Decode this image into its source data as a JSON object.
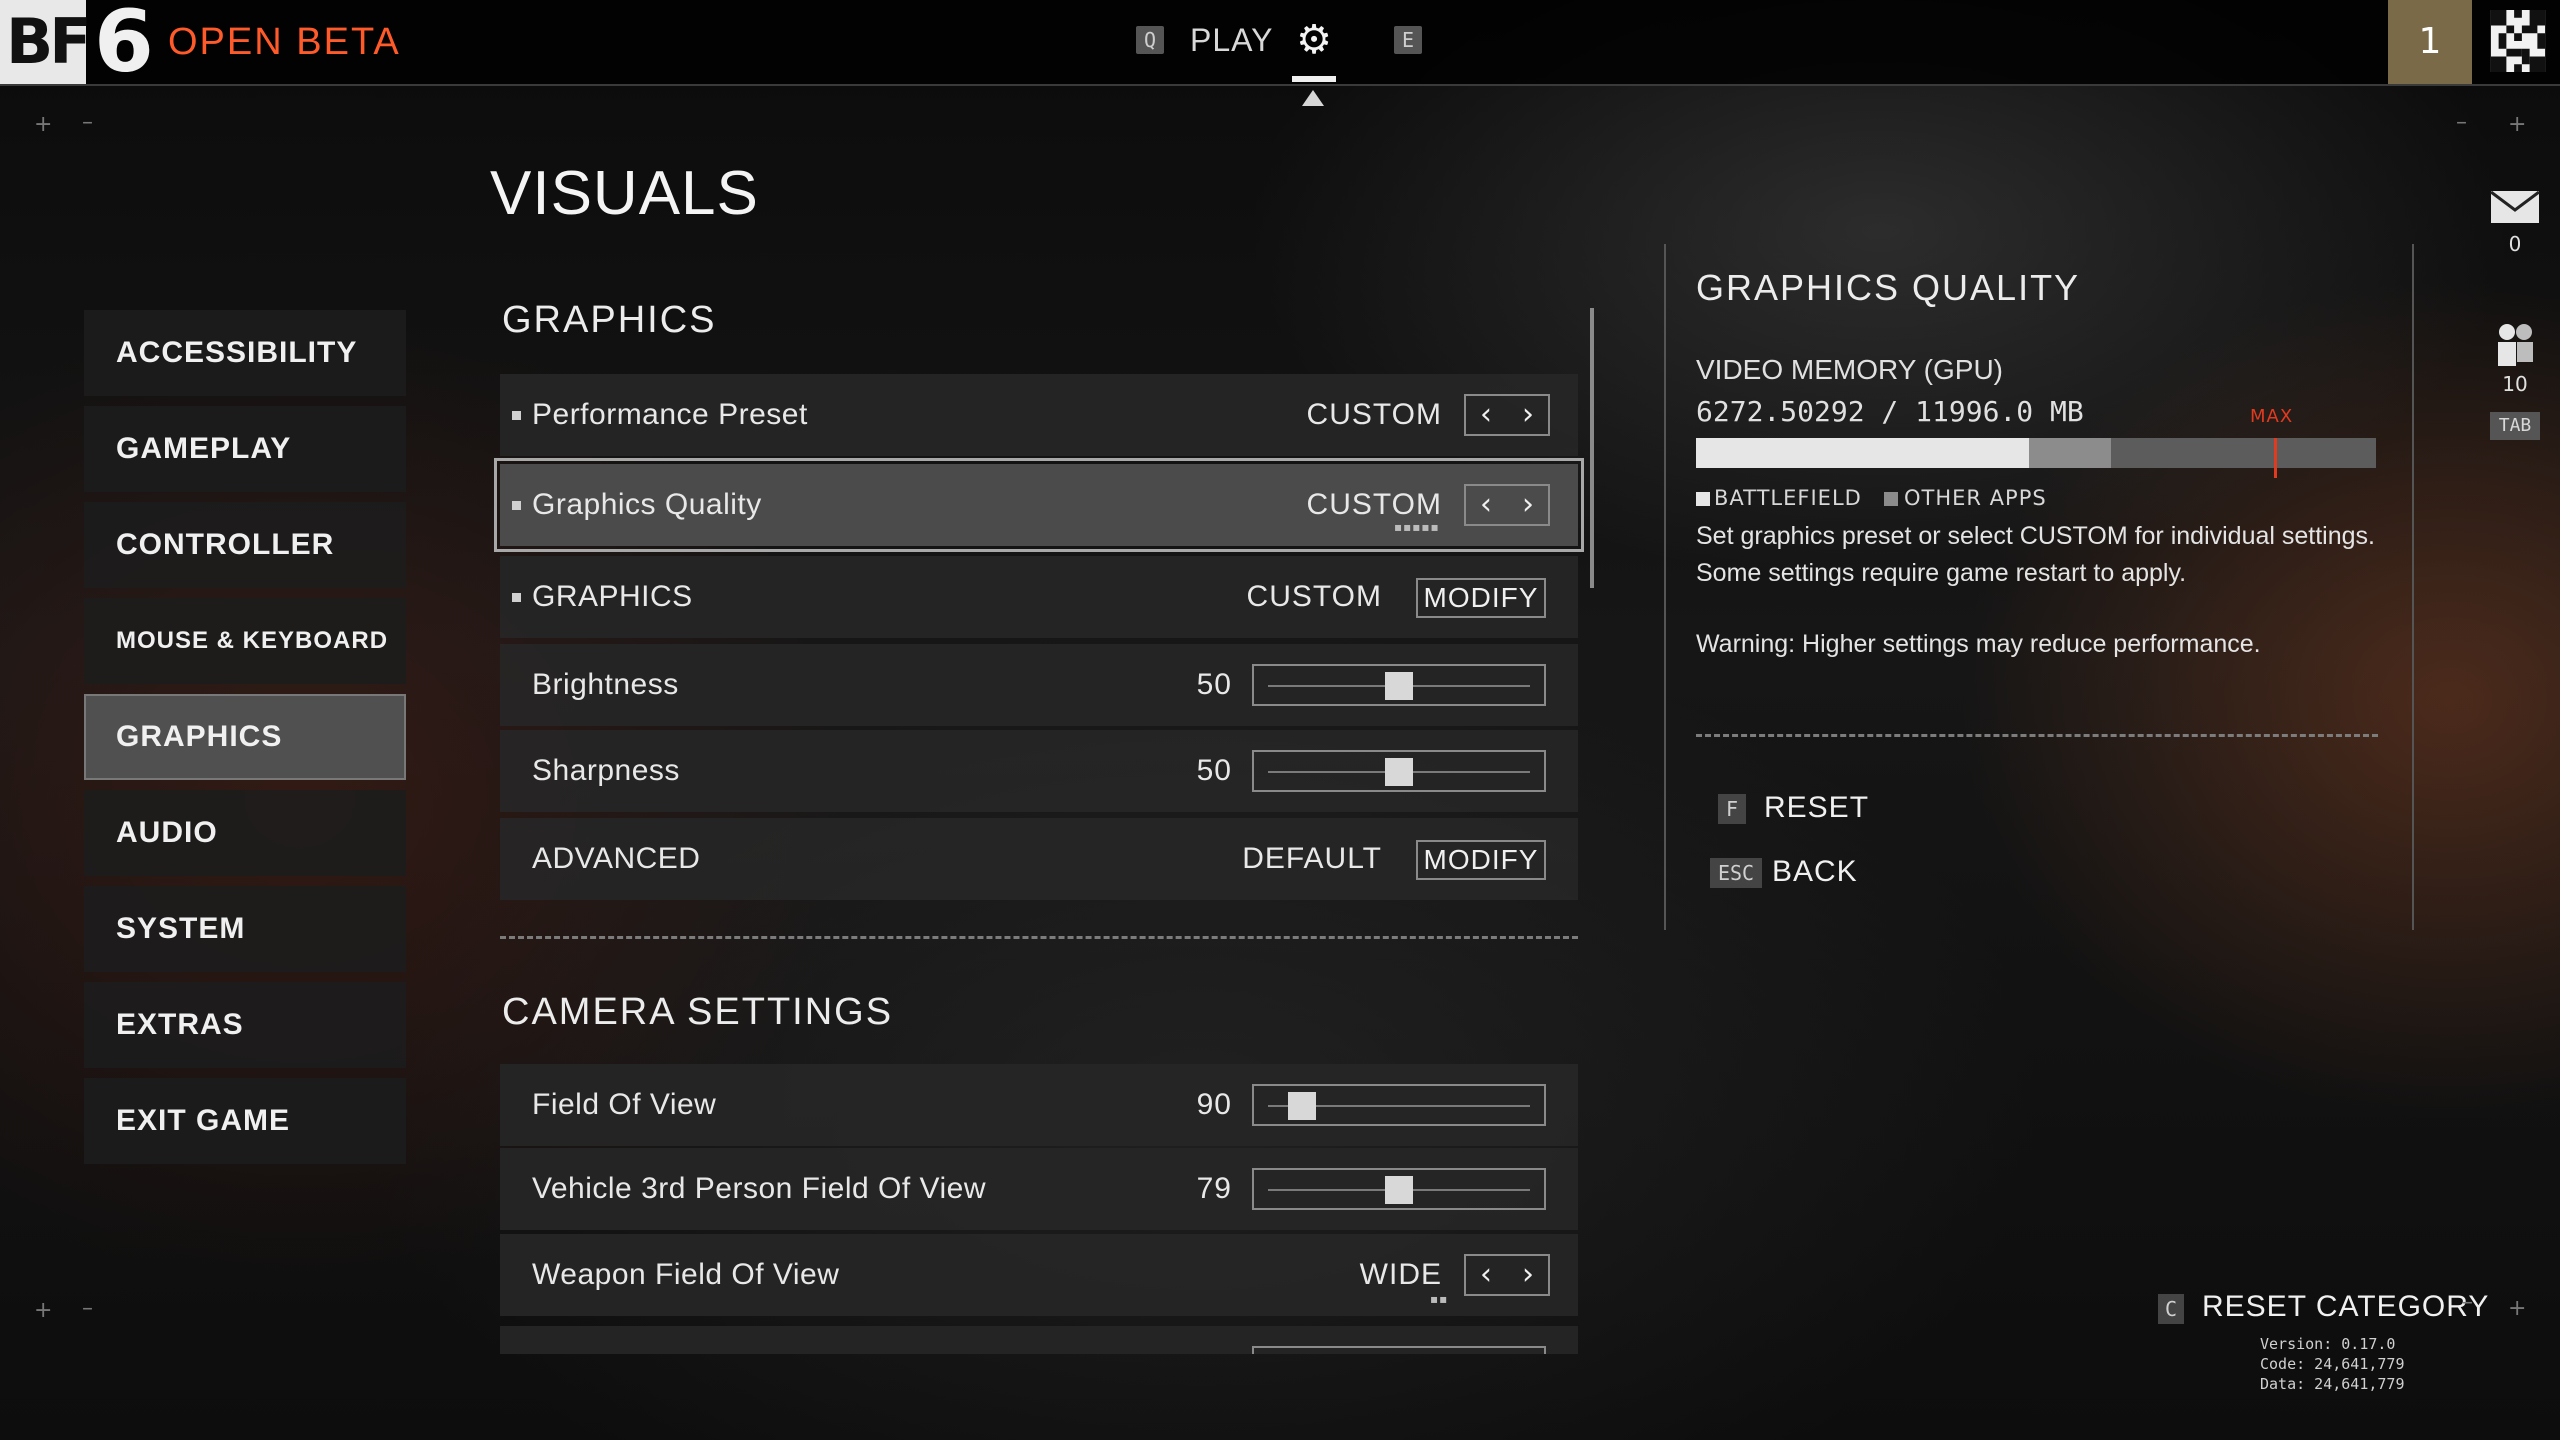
{
  "header": {
    "logo_bf": "BF",
    "logo_number": "6",
    "subtitle": "OPEN BETA",
    "key_left": "Q",
    "play_label": "PLAY",
    "settings_icon": "gear-icon",
    "key_right": "E",
    "squad_number": "1",
    "accent_color": "#ff5a2a"
  },
  "page": {
    "title": "VISUALS"
  },
  "sidebar": {
    "items": [
      {
        "label": "ACCESSIBILITY"
      },
      {
        "label": "GAMEPLAY"
      },
      {
        "label": "CONTROLLER"
      },
      {
        "label": "MOUSE & KEYBOARD"
      },
      {
        "label": "GRAPHICS",
        "active": true
      },
      {
        "label": "AUDIO"
      },
      {
        "label": "SYSTEM"
      },
      {
        "label": "EXTRAS"
      },
      {
        "label": "EXIT GAME"
      }
    ]
  },
  "graphics_section": {
    "title": "GRAPHICS",
    "rows": [
      {
        "label": "Performance Preset",
        "value": "CUSTOM",
        "control": "stepper"
      },
      {
        "label": "Graphics Quality",
        "value": "CUSTOM",
        "control": "stepper",
        "selected": true
      },
      {
        "label": "GRAPHICS",
        "value": "CUSTOM",
        "control": "button",
        "button_label": "MODIFY"
      },
      {
        "label": "Brightness",
        "value": "50",
        "control": "slider",
        "level": 0.5
      },
      {
        "label": "Sharpness",
        "value": "50",
        "control": "slider",
        "level": 0.5
      },
      {
        "label": "ADVANCED",
        "value": "DEFAULT",
        "control": "button",
        "button_label": "MODIFY"
      }
    ]
  },
  "camera_section": {
    "title": "CAMERA SETTINGS",
    "rows": [
      {
        "label": "Field Of View",
        "value": "90",
        "control": "slider",
        "level": 0.13
      },
      {
        "label": "Vehicle 3rd Person Field Of View",
        "value": "79",
        "control": "slider",
        "level": 0.5
      },
      {
        "label": "Weapon Field Of View",
        "value": "WIDE",
        "control": "stepper"
      }
    ]
  },
  "info_panel": {
    "title": "GRAPHICS QUALITY",
    "vram_label": "VIDEO MEMORY (GPU)",
    "vram_value": "6272.50292 / 11996.0 MB",
    "vram_battlefield_fraction": 0.49,
    "vram_other_fraction": 0.12,
    "vram_max_fraction": 0.85,
    "max_label": "MAX",
    "legend_battlefield": "BATTLEFIELD",
    "legend_other": "OTHER APPS",
    "description": "Set graphics preset or select CUSTOM for individual settings. Some settings require game restart to apply.",
    "warning": "Warning: Higher settings may reduce performance.",
    "reset_key": "F",
    "reset_label": "RESET",
    "back_key": "ESC",
    "back_label": "BACK"
  },
  "right_rail": {
    "mail_count": "0",
    "friends_count": "10",
    "tab_key": "TAB"
  },
  "footer": {
    "reset_category_key": "C",
    "reset_category_label": "RESET CATEGORY",
    "version": "Version: 0.17.0",
    "code": "Code: 24,641,779",
    "data": "Data: 24,641,779"
  }
}
